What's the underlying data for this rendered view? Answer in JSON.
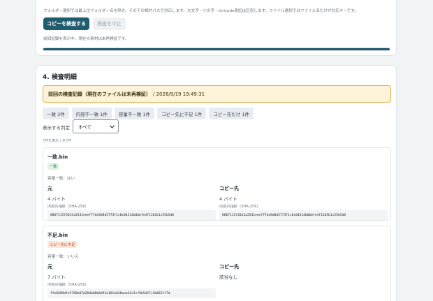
{
  "copy_panel": {
    "note": "フォルダー選択では最上位フォルダー名を除き、その下の相対パスで対応します。大文字・小文字・Unicode表記は区別します。ファイル選択ではファイル名だけが対応キーです。",
    "verify_button": "コピーを検査する",
    "cancel_button": "検査を中止",
    "status": "前回記録を表示中。現在の素材は未再検証です。",
    "progress": 1.0
  },
  "details": {
    "title": "4. 検査明細",
    "banner_strong": "前回の検査記録（現在のファイルは未再検証）",
    "banner_timestamp": "/ 2026/9/19 19:49:31",
    "chips": [
      "一致 3件",
      "内容不一致 1件",
      "容量不一致 1件",
      "コピー先に不足 1件",
      "コピー先だけ 1件"
    ],
    "filter_label": "表示する判定",
    "filter_value": "すべて",
    "count_text": "7件を表示 / 全7件",
    "entries": [
      {
        "name": "一致.bin",
        "badge": "一致",
        "size_equal": "容量一致：はい",
        "source_label": "元",
        "source_size": "4 バイト",
        "source_hash_label": "内容の指紋（SHA-256）",
        "source_hash": "8867115f2013a2541eeef77de8d8d5773f1c0c04314b0bbfe4f13b5b1c55b5d8",
        "dest_label": "コピー先",
        "dest_size": "4 バイト",
        "dest_hash_label": "内容の指紋（SHA-256）",
        "dest_hash": "8867115f2013a2541eeef77de8d8d5773f1c0c04314b0bbfe4f13b5b1c55b5d8"
      },
      {
        "name": "不足.bin",
        "badge": "コピー先に不足",
        "size_equal": "容量一致：いいえ",
        "source_label": "元",
        "source_size": "7 バイト",
        "source_hash_label": "内容の指紋（SHA-256）",
        "source_hash": "ffe0589dfe5768b07d284b08b0d93a161e848aea42c5cf6b5d27c3b0621f7d",
        "dest_label": "コピー先",
        "dest_missing": "該当なし"
      }
    ]
  },
  "colors": {
    "primary": "#1f5c6e",
    "banner_bg": "#fdf3d8",
    "banner_border": "#e3b356",
    "ok_badge": "#e2f2e6",
    "warn_badge": "#fde6d8"
  }
}
